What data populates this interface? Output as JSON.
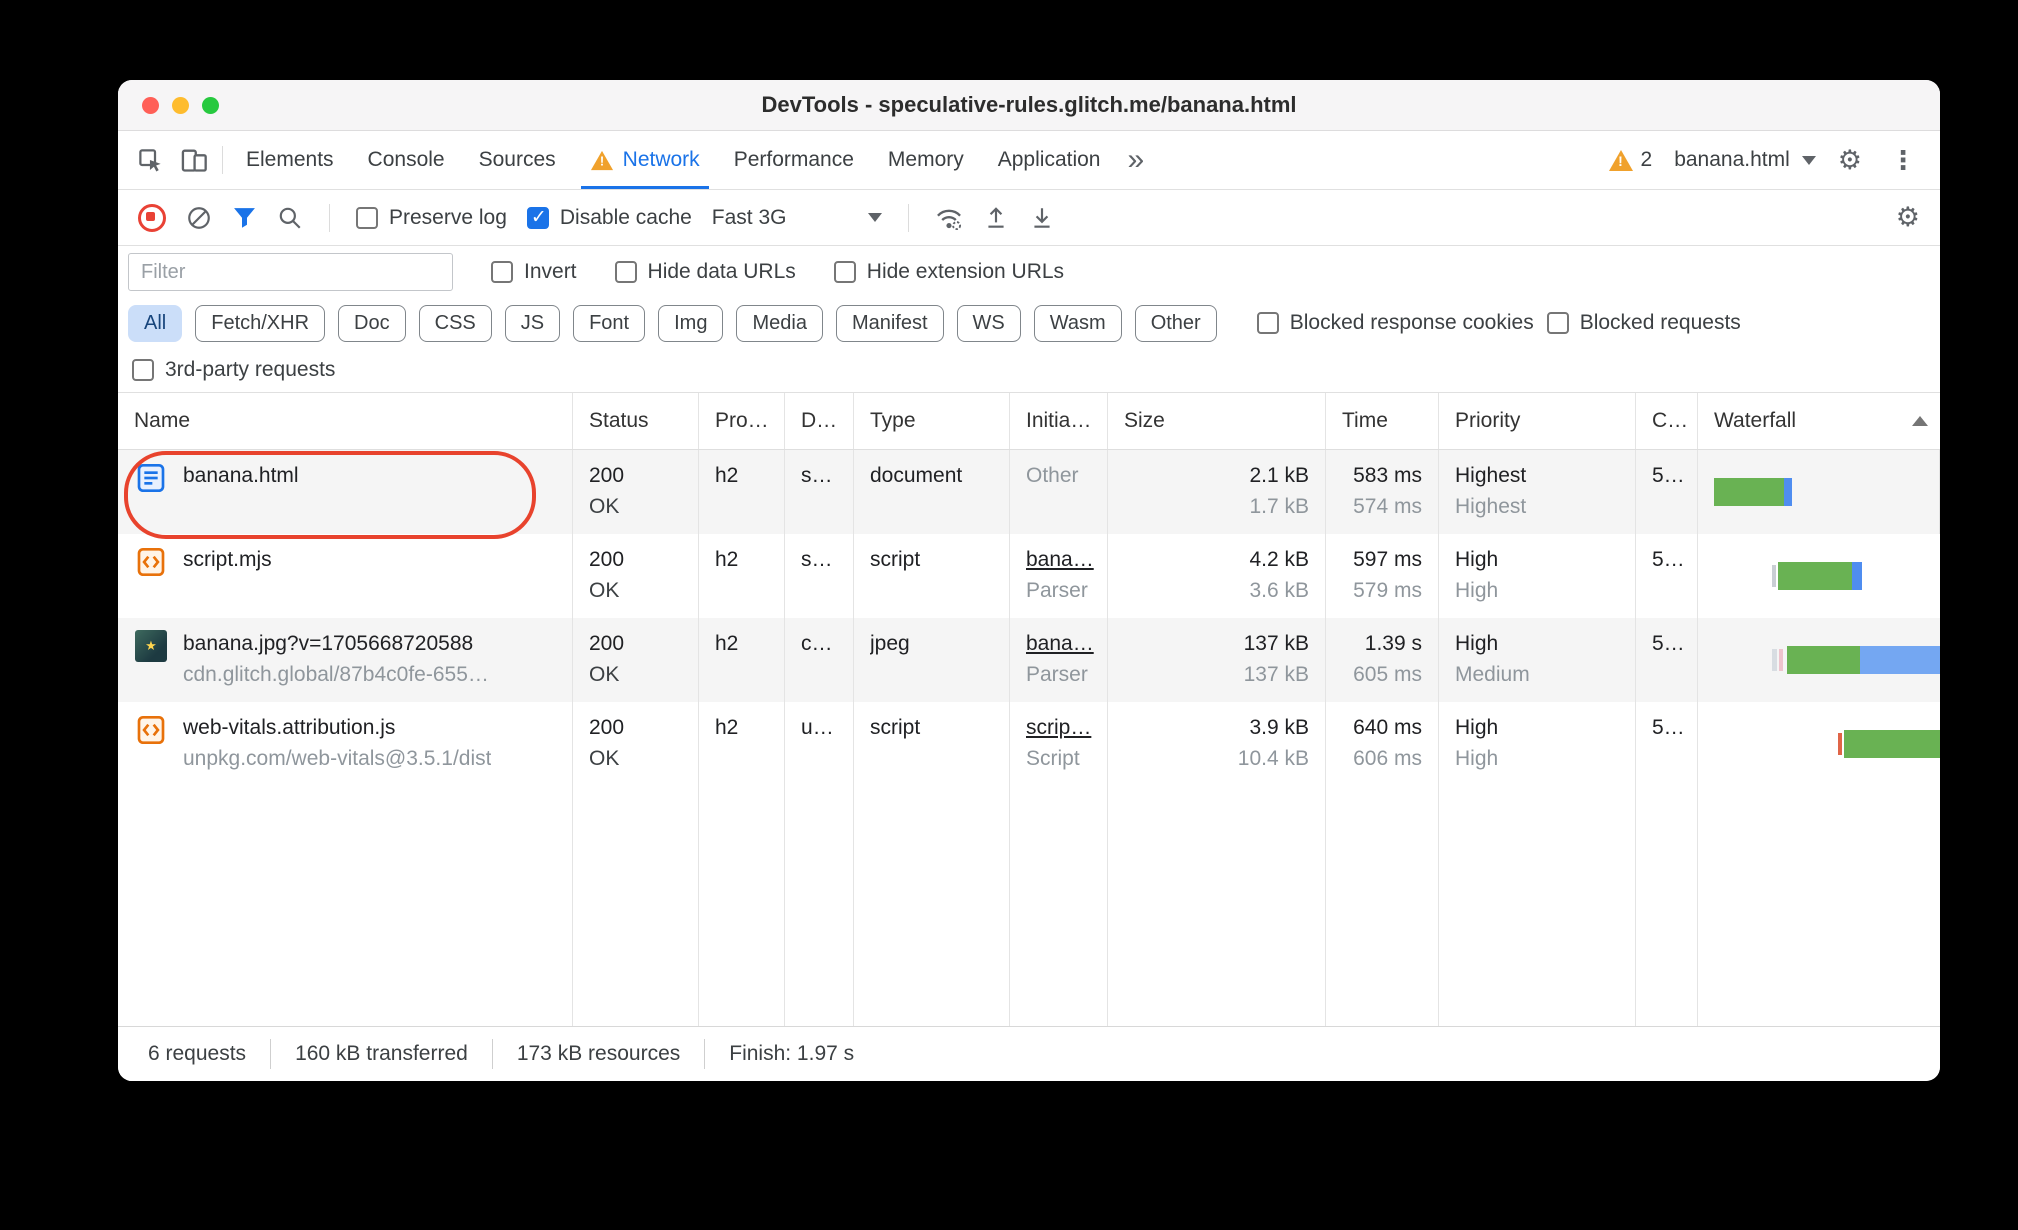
{
  "window": {
    "title": "DevTools - speculative-rules.glitch.me/banana.html"
  },
  "tab_bar": {
    "tabs": [
      "Elements",
      "Console",
      "Sources",
      "Network",
      "Performance",
      "Memory",
      "Application"
    ],
    "more_tabs": "»",
    "warning_count": "2",
    "page_selector": "banana.html"
  },
  "network_toolbar": {
    "preserve_log": "Preserve log",
    "disable_cache": "Disable cache",
    "throttling": "Fast 3G"
  },
  "filter_bar": {
    "filter_placeholder": "Filter",
    "invert": "Invert",
    "hide_data_urls": "Hide data URLs",
    "hide_extension_urls": "Hide extension URLs",
    "chips": [
      "All",
      "Fetch/XHR",
      "Doc",
      "CSS",
      "JS",
      "Font",
      "Img",
      "Media",
      "Manifest",
      "WS",
      "Wasm",
      "Other"
    ],
    "blocked_response_cookies": "Blocked response cookies",
    "blocked_requests": "Blocked requests",
    "third_party_requests": "3rd-party requests"
  },
  "table": {
    "columns": [
      "Name",
      "Status",
      "Pro…",
      "D…",
      "Type",
      "Initia…",
      "Size",
      "Time",
      "Priority",
      "C…",
      "Waterfall"
    ],
    "rows": [
      {
        "name": "banana.html",
        "sub": "",
        "status": "200",
        "status_text": "OK",
        "protocol": "h2",
        "domain": "sp…",
        "type": "document",
        "initiator": "Other",
        "initiator_sub": "",
        "size": "2.1 kB",
        "size_sub": "1.7 kB",
        "time": "583 ms",
        "time_sub": "574 ms",
        "priority": "Highest",
        "priority_sub": "Highest",
        "connection": "5…"
      },
      {
        "name": "script.mjs",
        "sub": "",
        "status": "200",
        "status_text": "OK",
        "protocol": "h2",
        "domain": "sp…",
        "type": "script",
        "initiator": "bana…",
        "initiator_sub": "Parser",
        "size": "4.2 kB",
        "size_sub": "3.6 kB",
        "time": "597 ms",
        "time_sub": "579 ms",
        "priority": "High",
        "priority_sub": "High",
        "connection": "5…"
      },
      {
        "name": "banana.jpg?v=1705668720588",
        "sub": "cdn.glitch.global/87b4c0fe-655…",
        "status": "200",
        "status_text": "OK",
        "protocol": "h2",
        "domain": "cd…",
        "type": "jpeg",
        "initiator": "bana…",
        "initiator_sub": "Parser",
        "size": "137 kB",
        "size_sub": "137 kB",
        "time": "1.39 s",
        "time_sub": "605 ms",
        "priority": "High",
        "priority_sub": "Medium",
        "connection": "5…"
      },
      {
        "name": "web-vitals.attribution.js",
        "sub": "unpkg.com/web-vitals@3.5.1/dist",
        "status": "200",
        "status_text": "OK",
        "protocol": "h2",
        "domain": "un…",
        "type": "script",
        "initiator": "scrip…",
        "initiator_sub": "Script",
        "size": "3.9 kB",
        "size_sub": "10.4 kB",
        "time": "640 ms",
        "time_sub": "606 ms",
        "priority": "High",
        "priority_sub": "High",
        "connection": "5…"
      }
    ]
  },
  "status_bar": {
    "requests": "6 requests",
    "transferred": "160 kB transferred",
    "resources": "173 kB resources",
    "finish": "Finish: 1.97 s"
  }
}
